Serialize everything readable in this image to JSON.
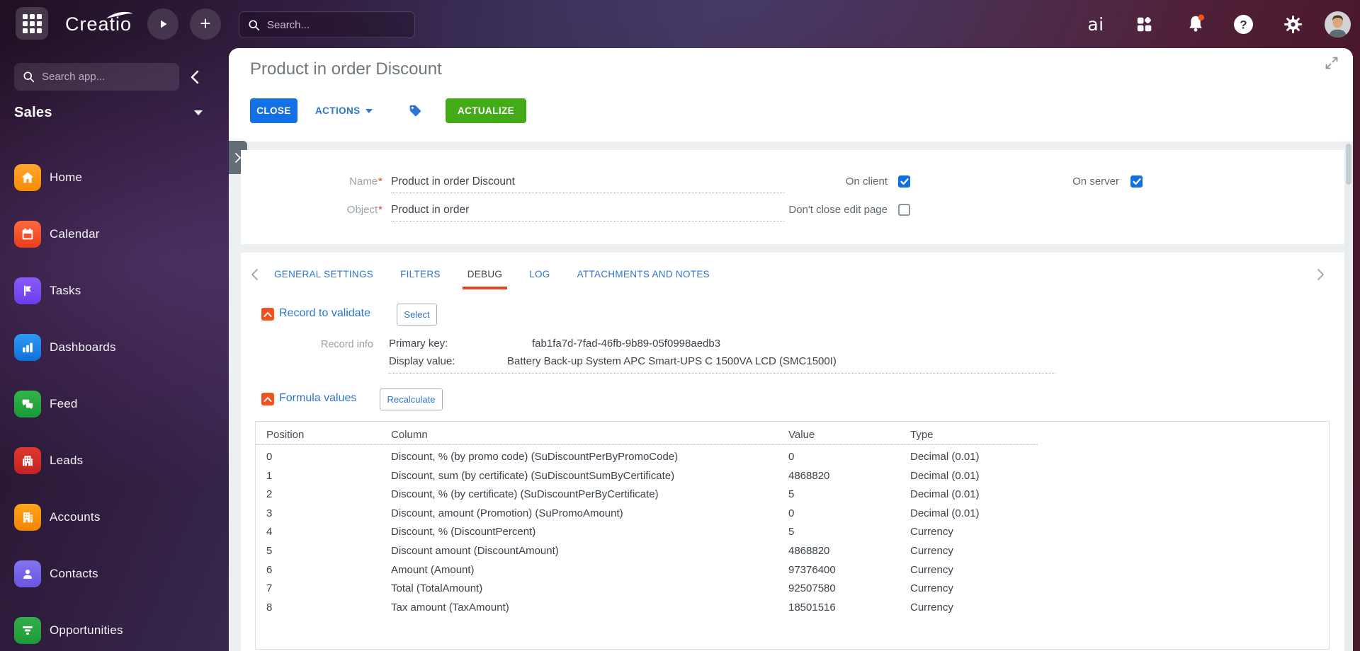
{
  "app": {
    "logo_text": "Creatio"
  },
  "topbar": {
    "search_placeholder": "Search...",
    "copilot_label": "ai"
  },
  "sidebar": {
    "search_placeholder": "Search app...",
    "workspace_label": "Sales",
    "items": [
      {
        "label": "Home",
        "icon": "home-icon",
        "color_top": "#ffa733",
        "color_bottom": "#f98a00"
      },
      {
        "label": "Calendar",
        "icon": "calendar-icon",
        "color_top": "#ff6a3d",
        "color_bottom": "#ea3d1d"
      },
      {
        "label": "Tasks",
        "icon": "flag-icon",
        "color_top": "#8a5bf7",
        "color_bottom": "#6c3bef"
      },
      {
        "label": "Dashboards",
        "icon": "bar-chart-icon",
        "color_top": "#2f9bf4",
        "color_bottom": "#0e6fd9"
      },
      {
        "label": "Feed",
        "icon": "chat-icon",
        "color_top": "#33b44a",
        "color_bottom": "#189a37"
      },
      {
        "label": "Leads",
        "icon": "leads-building-icon",
        "color_top": "#e0392e",
        "color_bottom": "#c22323"
      },
      {
        "label": "Accounts",
        "icon": "accounts-building-icon",
        "color_top": "#ffa51e",
        "color_bottom": "#f58300"
      },
      {
        "label": "Contacts",
        "icon": "person-icon",
        "color_top": "#8274ee",
        "color_bottom": "#6a55e0"
      },
      {
        "label": "Opportunities",
        "icon": "funnel-icon",
        "color_top": "#33ad4b",
        "color_bottom": "#1d9a39"
      }
    ]
  },
  "page": {
    "title": "Product in order Discount",
    "close_label": "CLOSE",
    "actions_label": "ACTIONS",
    "actualize_label": "ACTUALIZE"
  },
  "form": {
    "required_marker": "*",
    "name_label": "Name",
    "name_value": "Product in order Discount",
    "object_label": "Object",
    "object_value": "Product in order",
    "on_client_label": "On client",
    "on_client_checked": true,
    "on_server_label": "On server",
    "on_server_checked": true,
    "dont_close_label": "Don't close edit page",
    "dont_close_checked": false
  },
  "tabs": {
    "items": [
      {
        "label": "GENERAL SETTINGS",
        "active": false
      },
      {
        "label": "FILTERS",
        "active": false
      },
      {
        "label": "DEBUG",
        "active": true
      },
      {
        "label": "LOG",
        "active": false
      },
      {
        "label": "ATTACHMENTS AND NOTES",
        "active": false
      }
    ]
  },
  "record_section": {
    "title": "Record to validate",
    "select_label": "Select",
    "record_info_label": "Record info",
    "primary_key_label": "Primary key:",
    "primary_key_value": "fab1fa7d-7fad-46fb-9b89-05f0998aedb3",
    "display_value_label": "Display value:",
    "display_value": "Battery Back-up System APC Smart-UPS C 1500VA LCD (SMC1500I)"
  },
  "formula_section": {
    "title": "Formula values",
    "recalculate_label": "Recalculate",
    "table": {
      "headers": [
        "Position",
        "Column",
        "Value",
        "Type"
      ],
      "rows": [
        [
          "0",
          "Discount, % (by promo code) (SuDiscountPerByPromoCode)",
          "0",
          "Decimal (0.01)"
        ],
        [
          "1",
          "Discount, sum (by certificate) (SuDiscountSumByCertificate)",
          "4868820",
          "Decimal (0.01)"
        ],
        [
          "2",
          "Discount, % (by certificate) (SuDiscountPerByCertificate)",
          "5",
          "Decimal (0.01)"
        ],
        [
          "3",
          "Discount, amount (Promotion) (SuPromoAmount)",
          "0",
          "Decimal (0.01)"
        ],
        [
          "4",
          "Discount, % (DiscountPercent)",
          "5",
          "Currency"
        ],
        [
          "5",
          "Discount amount (DiscountAmount)",
          "4868820",
          "Currency"
        ],
        [
          "6",
          "Amount (Amount)",
          "97376400",
          "Currency"
        ],
        [
          "7",
          "Total (TotalAmount)",
          "92507580",
          "Currency"
        ],
        [
          "8",
          "Tax amount (TaxAmount)",
          "18501516",
          "Currency"
        ]
      ]
    }
  },
  "colors": {
    "button_blue": "#1470e6",
    "link_blue": "#2e76d0",
    "button_green": "#43ab17",
    "section_orange": "#f4511c",
    "active_tab_underline": "#e5471d",
    "notification_dot": "#f4511e"
  }
}
